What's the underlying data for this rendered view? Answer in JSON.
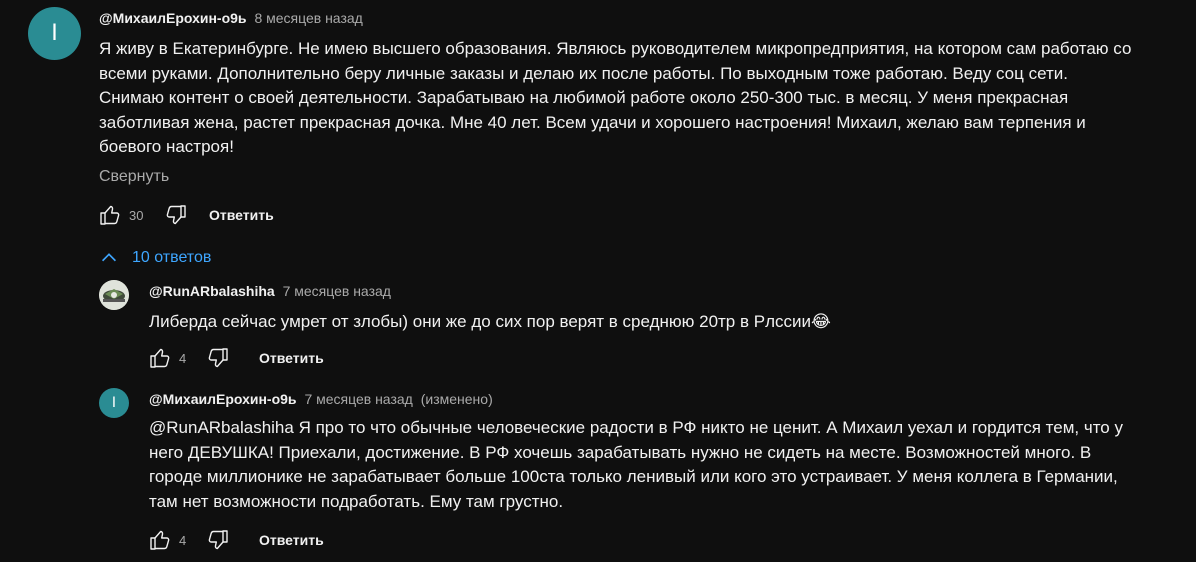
{
  "comment": {
    "avatar_letter": "I",
    "author": "@МихаилЕрохин-о9ь",
    "time": "8 месяцев назад",
    "lines": [
      "Я живу в Екатеринбурге. Не имею высшего образования. Являюсь руководителем микропредприятия, на котором сам работаю со",
      "всеми руками. Дополнительно беру личные заказы и делаю их после работы. По выходным тоже работаю. Веду соц сети.",
      "Снимаю контент о своей деятельности. Зарабатываю на любимой работе около 250-300 тыс. в месяц. У меня прекрасная",
      "заботливая жена, растет прекрасная дочка. Мне 40 лет. Всем удачи и хорошего настроения! Михаил, желаю вам терпения и",
      "боевого настроя!"
    ],
    "collapse_label": "Свернуть",
    "likes": "30",
    "reply_label": "Ответить"
  },
  "replies_toggle": {
    "icon": "chevron-up-icon",
    "label": "10 ответов",
    "color": "#3ea6ff"
  },
  "replies": [
    {
      "author": "@RunARbalashiha",
      "time": "7 месяцев назад",
      "edited": "",
      "lines": [
        "Либерда сейчас умрет от злобы) они же до сих пор верят в среднюю 20тр в Рлссии😂"
      ],
      "likes": "4",
      "reply_label": "Ответить"
    },
    {
      "avatar_letter": "I",
      "author": "@МихаилЕрохин-о9ь",
      "time": "7 месяцев назад",
      "edited": "(изменено)",
      "lines": [
        "@RunARbalashiha  Я про то что обычные человеческие радости в РФ никто не ценит. А Михаил уехал и гордится тем, что у",
        "него ДЕВУШКА! Приехали, достижение. В РФ хочешь зарабатывать нужно не сидеть на месте. Возможностей много. В",
        "городе миллионике не зарабатывает больше 100ста только ленивый или кого это устраивает. У меня коллега в Германии,",
        "там нет возможности подработать. Ему там грустно."
      ],
      "likes": "4",
      "reply_label": "Ответить"
    }
  ],
  "colors": {
    "background": "#0f0f0f",
    "text": "#f1f1f1",
    "secondary": "#aaaaaa",
    "avatar": "#2a8c93",
    "link": "#3ea6ff"
  }
}
